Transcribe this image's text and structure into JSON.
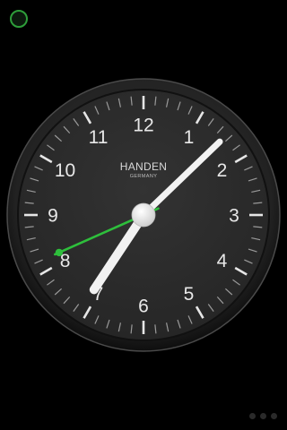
{
  "clock": {
    "brand": "HANDEN",
    "brand_sub": "GERMANY",
    "numerals": [
      "12",
      "1",
      "2",
      "3",
      "4",
      "5",
      "6",
      "7",
      "8",
      "9",
      "10",
      "11"
    ],
    "time": {
      "hours": 7,
      "minutes": 7,
      "seconds": 41
    }
  },
  "colors": {
    "background": "#000000",
    "dial": "#2b2b2b",
    "hands": "#f2f2f2",
    "second_hand": "#2ebf3c",
    "indicator": "#2e9e3a"
  },
  "icons": {
    "status_indicator": "green-ring-icon",
    "pagination": "page-dots"
  },
  "pagination": {
    "page_count": 3,
    "current_page": 1
  }
}
